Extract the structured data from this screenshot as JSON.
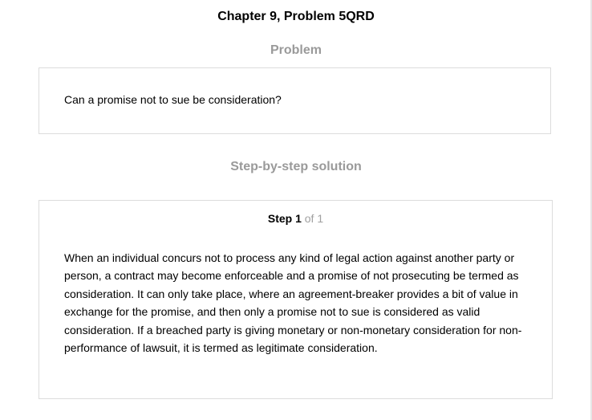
{
  "chapter_title": "Chapter 9, Problem 5QRD",
  "problem": {
    "heading": "Problem",
    "text": "Can a promise not to sue be consideration?"
  },
  "solution": {
    "heading": "Step-by-step solution",
    "step_label": "Step 1",
    "step_total": "of 1",
    "text": "When an individual concurs not to process any kind of legal action against another party or person, a contract may become enforceable and a promise of not prosecuting be termed as consideration. It can only take place, where an agreement-breaker provides a bit of value in exchange for the promise, and then only a promise not to sue is considered as valid consideration. If a breached party is giving monetary or non-monetary consideration for non-performance of lawsuit, it is termed as legitimate consideration."
  }
}
